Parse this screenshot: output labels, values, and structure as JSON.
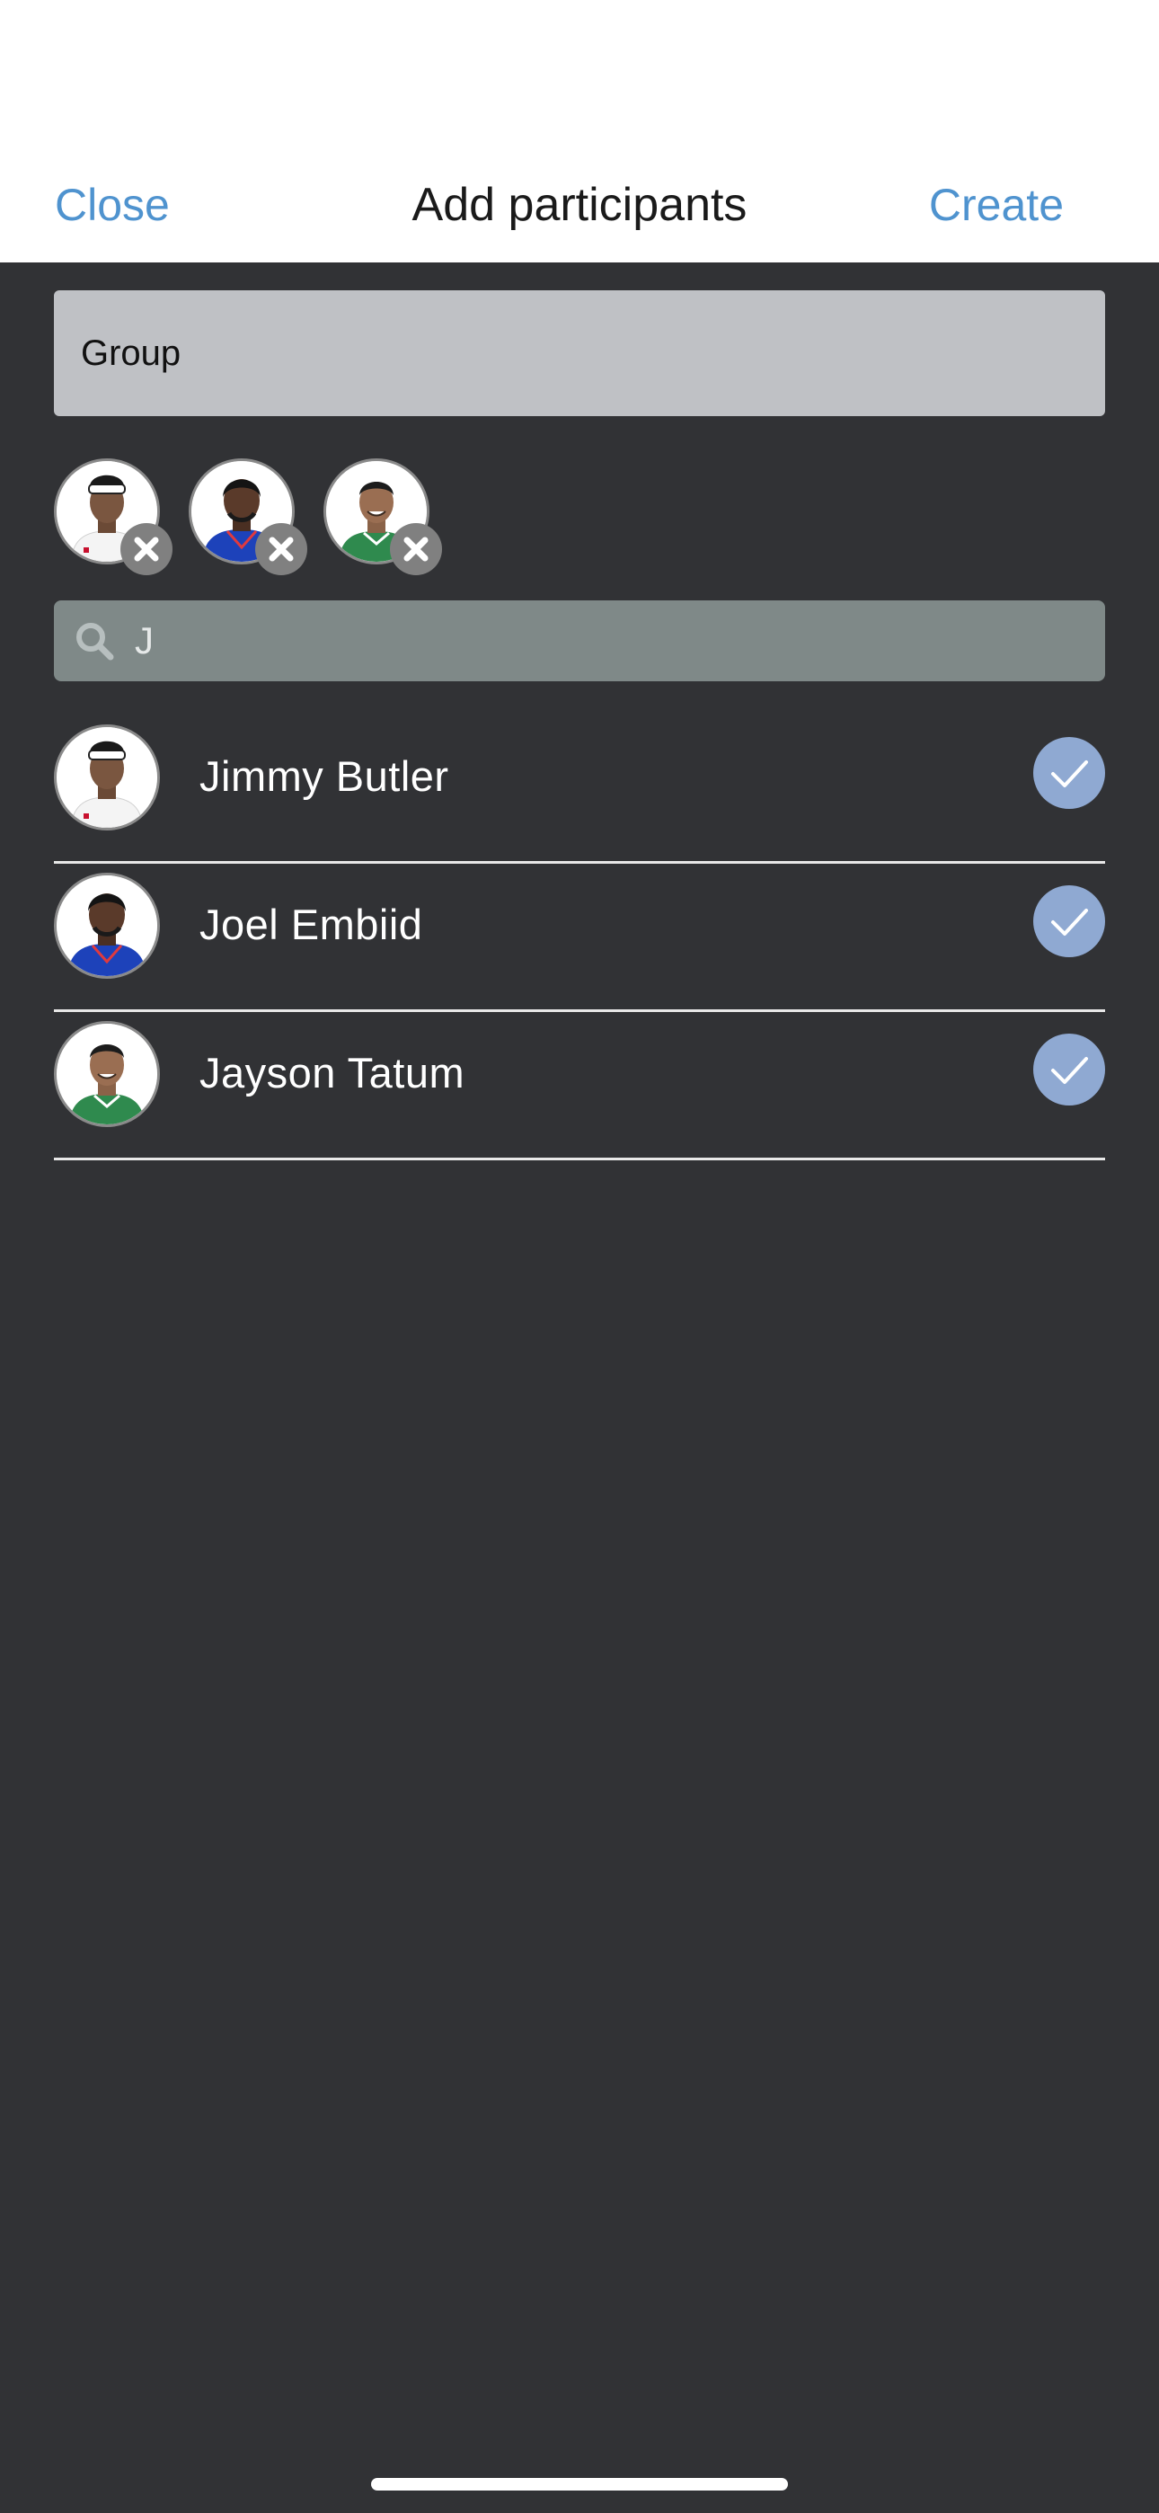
{
  "header": {
    "close_label": "Close",
    "title": "Add participants",
    "create_label": "Create"
  },
  "group_name": {
    "value": "Group"
  },
  "selected_participants": [
    {
      "name": "Jimmy Butler",
      "jersey": "#ffffff",
      "accent": "#c8102e"
    },
    {
      "name": "Joel Embiid",
      "jersey": "#1d42ba",
      "accent": "#e03a3e"
    },
    {
      "name": "Jayson Tatum",
      "jersey": "#2f8a4e",
      "accent": "#ffffff"
    }
  ],
  "search": {
    "value": "J",
    "icon": "search-icon"
  },
  "results": [
    {
      "name": "Jimmy Butler",
      "checked": true,
      "jersey": "#ffffff",
      "accent": "#c8102e"
    },
    {
      "name": "Joel Embiid",
      "checked": true,
      "jersey": "#1d42ba",
      "accent": "#e03a3e"
    },
    {
      "name": "Jayson Tatum",
      "checked": true,
      "jersey": "#2f8a4e",
      "accent": "#ffffff"
    }
  ],
  "colors": {
    "accent": "#4f93cf",
    "background": "#313235",
    "check": "#8fa9d2"
  }
}
